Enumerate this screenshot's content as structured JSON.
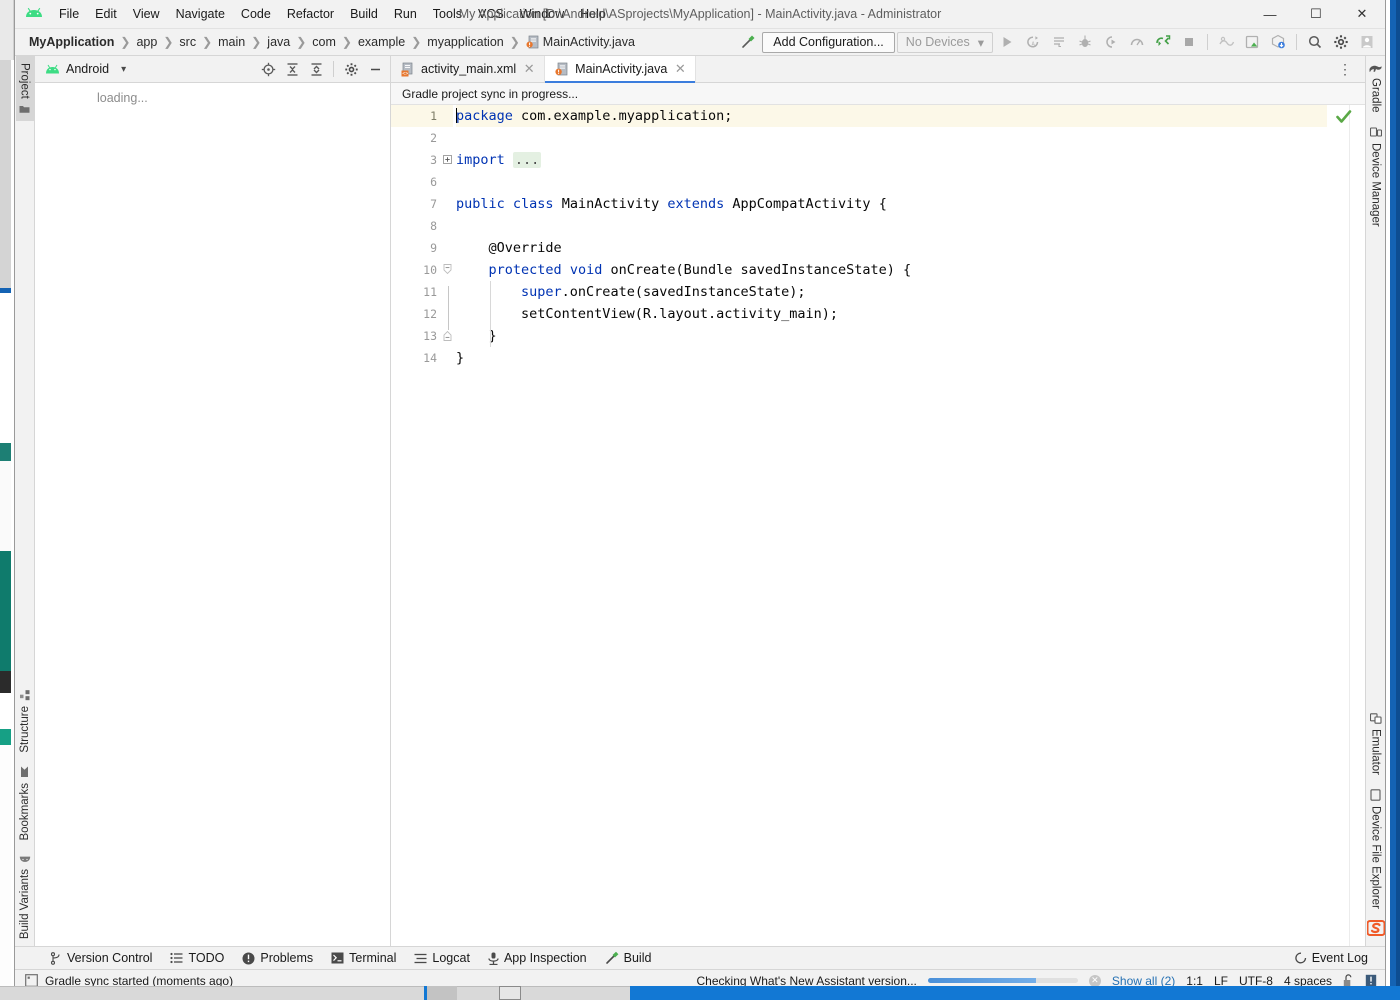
{
  "window": {
    "title": "My Application [D:\\Android\\ASprojects\\MyApplication] - MainActivity.java - Administrator",
    "minimize": "—",
    "maximize": "☐",
    "close": "✕"
  },
  "menu": [
    {
      "label": "File"
    },
    {
      "label": "Edit"
    },
    {
      "label": "View"
    },
    {
      "label": "Navigate"
    },
    {
      "label": "Code"
    },
    {
      "label": "Refactor"
    },
    {
      "label": "Build"
    },
    {
      "label": "Run"
    },
    {
      "label": "Tools"
    },
    {
      "label": "VCS"
    },
    {
      "label": "Window"
    },
    {
      "label": "Help"
    }
  ],
  "breadcrumb": {
    "separator": "❯",
    "items": [
      {
        "label": "MyApplication",
        "bold": true
      },
      {
        "label": "app",
        "bold": false
      },
      {
        "label": "src",
        "bold": false
      },
      {
        "label": "main",
        "bold": false
      },
      {
        "label": "java",
        "bold": false
      },
      {
        "label": "com",
        "bold": false
      },
      {
        "label": "example",
        "bold": false
      },
      {
        "label": "myapplication",
        "bold": false
      },
      {
        "label": "MainActivity.java",
        "bold": false,
        "icon": "java-class-icon"
      }
    ]
  },
  "toolbar": {
    "add_configuration": "Add Configuration...",
    "devices": "No Devices",
    "devices_caret": "▾",
    "icons": [
      "run-icon",
      "run-with-coverage-icon",
      "profile-icon",
      "debug-icon",
      "attach-debugger-icon",
      "profiler-icon",
      "sync-project-icon",
      "stop-icon"
    ],
    "icons2": [
      "avd-manager-icon",
      "layout-inspector-icon",
      "sdk-manager-icon"
    ],
    "icons3": [
      "search-icon",
      "settings-gear-icon",
      "user-account-icon"
    ]
  },
  "left_strip": {
    "top": [
      {
        "label": "Project",
        "icon": "folder-icon",
        "active": true
      }
    ],
    "bottom": [
      {
        "label": "Structure",
        "icon": "structure-icon",
        "active": false
      },
      {
        "label": "Bookmarks",
        "icon": "bookmark-icon",
        "active": false
      },
      {
        "label": "Build Variants",
        "icon": "android-icon",
        "active": false
      }
    ]
  },
  "right_strip": {
    "top": [
      {
        "label": "Gradle",
        "icon": "gradle-elephant-icon",
        "active": false
      },
      {
        "label": "Device Manager",
        "icon": "device-manager-icon",
        "active": false
      }
    ],
    "bottom": [
      {
        "label": "Emulator",
        "icon": "emulator-icon",
        "active": false
      },
      {
        "label": "Device File Explorer",
        "icon": "device-file-explorer-icon",
        "active": false
      }
    ]
  },
  "project_panel": {
    "title": "Android",
    "caret": "▾",
    "loading": "loading...",
    "tools": [
      "select-opened-file-icon",
      "expand-all-icon",
      "collapse-all-icon",
      "settings-gear-icon",
      "hide-icon"
    ]
  },
  "editor": {
    "tabs": [
      {
        "label": "activity_main.xml",
        "icon": "xml-layout-icon",
        "active": false,
        "close": "✕"
      },
      {
        "label": "MainActivity.java",
        "icon": "java-class-icon",
        "active": true,
        "close": "✕"
      }
    ],
    "options_icon": "⋮",
    "notification": "Gradle project sync in progress...",
    "inspection_status": "inspection-ok-icon",
    "line_numbers": [
      "1",
      "2",
      "3",
      "6",
      "7",
      "8",
      "9",
      "10",
      "11",
      "12",
      "13",
      "14"
    ],
    "highlighted_line_index": 0,
    "lines": [
      {
        "n": "1",
        "indent": 0,
        "tokens": [
          {
            "t": "package",
            "k": true
          },
          {
            "t": " com.example.myapplication;",
            "k": false
          }
        ],
        "caret": true
      },
      {
        "n": "2",
        "indent": 0,
        "tokens": []
      },
      {
        "n": "3",
        "indent": 0,
        "tokens": [
          {
            "t": "import",
            "k": true
          },
          {
            "t": " ",
            "k": false
          },
          {
            "t": "...",
            "k": false,
            "fold": true
          }
        ],
        "fold_marker": "plus"
      },
      {
        "n": "6",
        "indent": 0,
        "tokens": []
      },
      {
        "n": "7",
        "indent": 0,
        "tokens": [
          {
            "t": "public",
            "k": true
          },
          {
            "t": " ",
            "k": false
          },
          {
            "t": "class",
            "k": true
          },
          {
            "t": " MainActivity ",
            "k": false
          },
          {
            "t": "extends",
            "k": true
          },
          {
            "t": " AppCompatActivity {",
            "k": false
          }
        ]
      },
      {
        "n": "8",
        "indent": 0,
        "tokens": []
      },
      {
        "n": "9",
        "indent": 1,
        "tokens": [
          {
            "t": "    @Override",
            "k": false
          }
        ]
      },
      {
        "n": "10",
        "indent": 1,
        "tokens": [
          {
            "t": "    ",
            "k": false
          },
          {
            "t": "protected",
            "k": true
          },
          {
            "t": " ",
            "k": false
          },
          {
            "t": "void",
            "k": true
          },
          {
            "t": " onCreate(Bundle savedInstanceState) {",
            "k": false
          }
        ],
        "fold_marker": "minus-top"
      },
      {
        "n": "11",
        "indent": 2,
        "tokens": [
          {
            "t": "        ",
            "k": false
          },
          {
            "t": "super",
            "k": true
          },
          {
            "t": ".onCreate(savedInstanceState);",
            "k": false
          }
        ]
      },
      {
        "n": "12",
        "indent": 2,
        "tokens": [
          {
            "t": "        setContentView(R.layout.activity_main);",
            "k": false
          }
        ]
      },
      {
        "n": "13",
        "indent": 1,
        "tokens": [
          {
            "t": "    }",
            "k": false
          }
        ],
        "fold_marker": "minus-bottom"
      },
      {
        "n": "14",
        "indent": 0,
        "tokens": [
          {
            "t": "}",
            "k": false
          }
        ]
      }
    ]
  },
  "bottom_tools": [
    {
      "label": "Version Control",
      "icon": "branch-icon"
    },
    {
      "label": "TODO",
      "icon": "todo-list-icon"
    },
    {
      "label": "Problems",
      "icon": "problems-icon"
    },
    {
      "label": "Terminal",
      "icon": "terminal-icon"
    },
    {
      "label": "Logcat",
      "icon": "logcat-icon"
    },
    {
      "label": "App Inspection",
      "icon": "app-inspection-icon"
    },
    {
      "label": "Build",
      "icon": "build-hammer-icon"
    }
  ],
  "event_log": {
    "label": "Event Log",
    "icon": "event-log-icon"
  },
  "statusbar": {
    "message_icon": "gradle-status-icon",
    "message": "Gradle sync started (moments ago)",
    "task": "Checking What's New Assistant version...",
    "progress_percent": 72,
    "cancel": "✕",
    "show_all": "Show all (2)",
    "caret_position": "1:1",
    "line_separator": "LF",
    "encoding": "UTF-8",
    "indent": "4 spaces",
    "lock_icon": "unlocked-icon",
    "notifications_icon": "notifications-icon"
  },
  "colors": {
    "accent_blue": "#3b7ddd",
    "keyword": "#0033b3",
    "highlight_line": "#fcf8e8",
    "chrome": "#f2f2f2",
    "taskbar_blue": "#1278d4",
    "android_green": "#3ddc84"
  }
}
